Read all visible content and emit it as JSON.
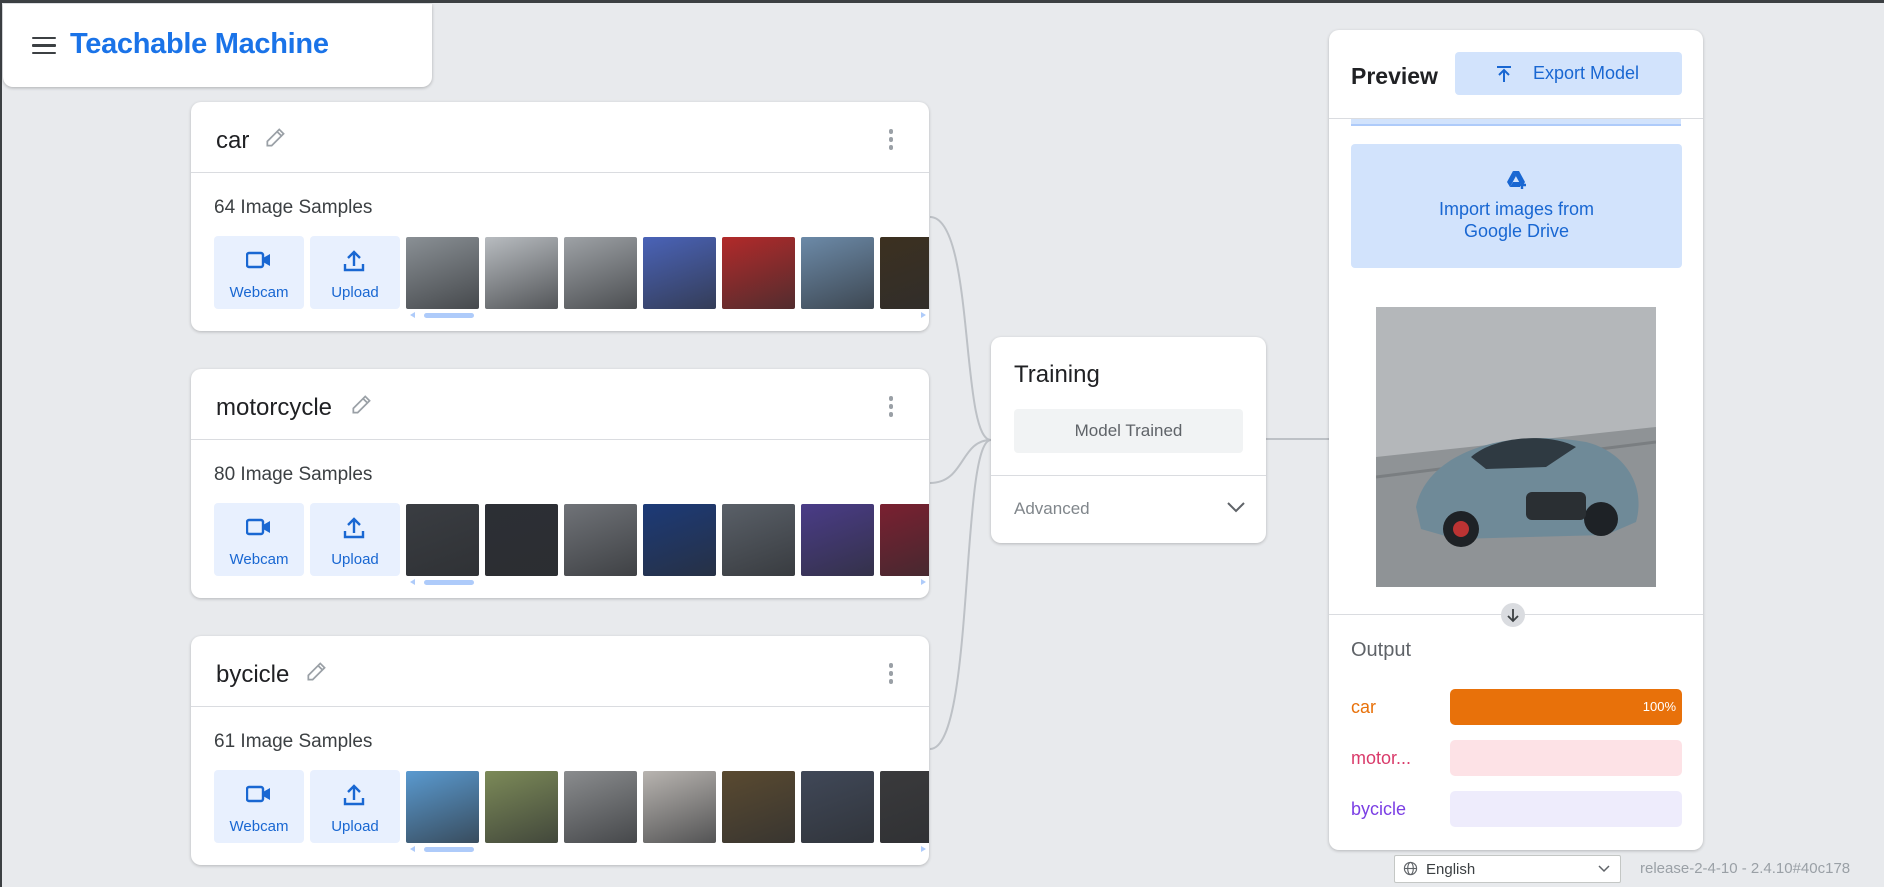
{
  "app": {
    "title": "Teachable Machine"
  },
  "classes": [
    {
      "name": "car",
      "samples_label": "64 Image Samples",
      "webcam_label": "Webcam",
      "upload_label": "Upload",
      "thumb_colors": [
        "#8a9095",
        "#b8bcc0",
        "#9ea2a6",
        "#4a63b8",
        "#b22a2a",
        "#6c8aa8",
        "#3c3020"
      ]
    },
    {
      "name": "motorcycle",
      "samples_label": "80 Image Samples",
      "webcam_label": "Webcam",
      "upload_label": "Upload",
      "thumb_colors": [
        "#3a3d42",
        "#2c2f35",
        "#707378",
        "#1c3a78",
        "#5a6068",
        "#4a3c88",
        "#7a2030"
      ]
    },
    {
      "name": "bycicle",
      "samples_label": "61 Image Samples",
      "webcam_label": "Webcam",
      "upload_label": "Upload",
      "thumb_colors": [
        "#5a9ad0",
        "#7c8a58",
        "#8a8c8e",
        "#b8b4b0",
        "#5a4a30",
        "#404858",
        "#3a3a3c"
      ]
    }
  ],
  "training": {
    "title": "Training",
    "button_label": "Model Trained",
    "advanced_label": "Advanced"
  },
  "preview": {
    "title": "Preview",
    "export_label": "Export Model",
    "drive_label_line1": "Import images from",
    "drive_label_line2": "Google Drive",
    "output_title": "Output",
    "outputs": [
      {
        "label": "car",
        "value": 1.0,
        "pct_text": "100%",
        "color": "#e8710a",
        "track": "#fde7d4"
      },
      {
        "label": "motor...",
        "value": 0.0,
        "pct_text": "",
        "color": "#d93a6a",
        "track": "#fde2e6"
      },
      {
        "label": "bycicle",
        "value": 0.0,
        "pct_text": "",
        "color": "#7b3fe4",
        "track": "#eeecfc"
      }
    ]
  },
  "footer": {
    "language": "English",
    "release": "release-2-4-10 - 2.4.10#40c178"
  }
}
